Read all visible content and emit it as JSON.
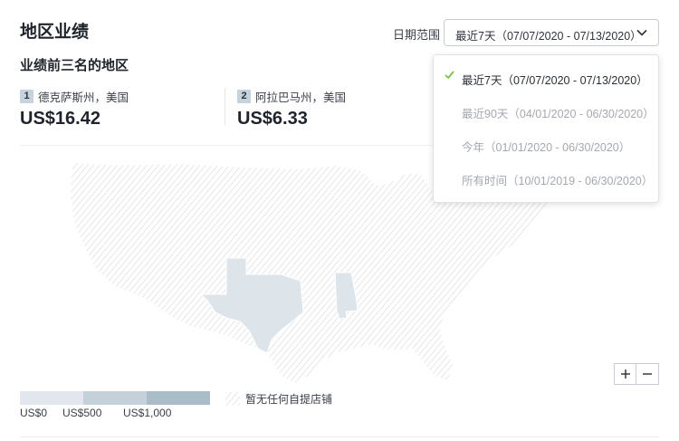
{
  "header": {
    "title": "地区业绩",
    "subtitle": "业绩前三名的地区"
  },
  "date_range": {
    "label": "日期范围",
    "selected": "最近7天（07/07/2020 - 07/13/2020）",
    "options": [
      {
        "label": "最近7天（07/07/2020 - 07/13/2020）",
        "selected": true
      },
      {
        "label": "最近90天（04/01/2020 - 06/30/2020）",
        "selected": false
      },
      {
        "label": "今年（01/01/2020 - 06/30/2020）",
        "selected": false
      },
      {
        "label": "所有时间（10/01/2019 - 06/30/2020）",
        "selected": false
      }
    ]
  },
  "top_regions": [
    {
      "rank": "1",
      "name": "德克萨斯州，美国",
      "amount": "US$16.42"
    },
    {
      "rank": "2",
      "name": "阿拉巴马州，美国",
      "amount": "US$6.33"
    }
  ],
  "legend": {
    "ticks": [
      "US$0",
      "US$500",
      "US$1,000"
    ],
    "no_store_label": "暂无任何自提店铺",
    "colors": [
      "#e1e7ec",
      "#c4d1da",
      "#a9bcc8"
    ]
  },
  "map": {
    "highlighted_states": [
      "Texas",
      "Alabama"
    ],
    "highlight_color": "#dde4ea",
    "hatch_color": "#d5d9de"
  },
  "zoom": {
    "in_icon": "plus-icon",
    "out_icon": "minus-icon"
  },
  "colors": {
    "check": "#7ac143",
    "border": "#c8ccd2"
  }
}
